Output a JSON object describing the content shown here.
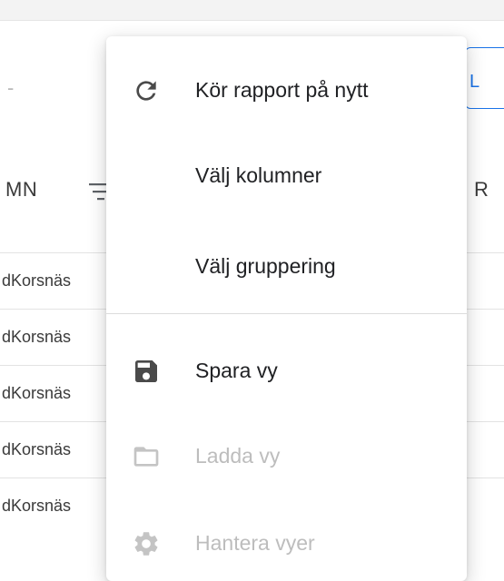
{
  "background": {
    "placeholder_dash": "-",
    "column_header": "MN",
    "right_header": "R",
    "export_button_label": "L",
    "rows": [
      "dKorsnäs",
      "dKorsnäs",
      "dKorsnäs",
      "dKorsnäs",
      "dKorsnäs"
    ]
  },
  "menu": {
    "items": [
      {
        "label": "Kör rapport på nytt",
        "icon": "refresh-icon",
        "disabled": false
      },
      {
        "label": "Välj kolumner",
        "icon": "",
        "disabled": false
      },
      {
        "label": "Välj gruppering",
        "icon": "",
        "disabled": false
      },
      {
        "label": "Spara vy",
        "icon": "save-icon",
        "disabled": false
      },
      {
        "label": "Ladda vy",
        "icon": "folder-icon",
        "disabled": true
      },
      {
        "label": "Hantera vyer",
        "icon": "gear-icon",
        "disabled": true
      }
    ]
  },
  "colors": {
    "accent": "#1a73e8",
    "icon_active": "#4a4a4a",
    "icon_disabled": "#c4c4c4",
    "text_disabled": "#bdbdbd"
  }
}
